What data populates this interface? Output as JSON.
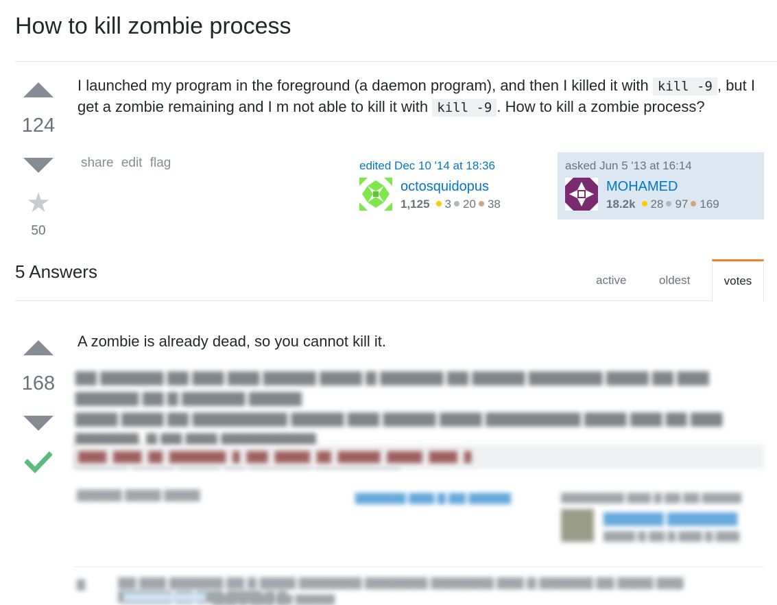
{
  "page_title": "How to kill zombie process",
  "question": {
    "votes": "124",
    "favorites": "50",
    "body": {
      "text1": "I launched my program in the foreground (a daemon program), and then I killed it with ",
      "code1": "kill -9",
      "text2": ", but I get a zombie remaining and I m not able to kill it with ",
      "code2": "kill -9",
      "text3": ". How to kill a zombie process?"
    },
    "menu": {
      "share": "share",
      "edit": "edit",
      "flag": "flag"
    },
    "edited": {
      "action": "edited Dec 10 '14 at 18:36",
      "user": "octosquidopus",
      "rep": "1,125",
      "gold": "3",
      "silver": "20",
      "bronze": "38"
    },
    "asked": {
      "action": "asked Jun 5 '13 at 16:14",
      "user": "MOHAMED",
      "rep": "18.2k",
      "gold": "28",
      "silver": "97",
      "bronze": "169"
    }
  },
  "answers_header": {
    "title": "5 Answers",
    "tabs": {
      "active": "active",
      "oldest": "oldest",
      "votes": "votes"
    },
    "selected_tab": "votes"
  },
  "answer": {
    "votes": "168",
    "accepted": true,
    "first_line": "A zombie is already dead, so you cannot kill it."
  },
  "colors": {
    "link": "#0077cc",
    "accent_tab": "#f48024",
    "accepted_check": "#5eba7d",
    "asked_sig_bg": "#dce7f1"
  }
}
